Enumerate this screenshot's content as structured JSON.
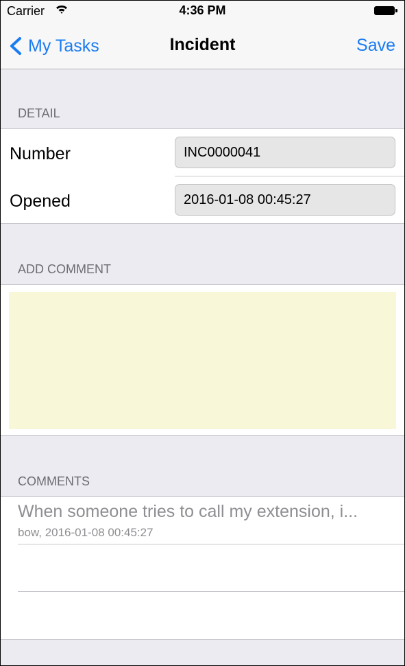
{
  "status_bar": {
    "carrier": "Carrier",
    "time": "4:36 PM"
  },
  "nav": {
    "back_label": "My Tasks",
    "title": "Incident",
    "save_label": "Save"
  },
  "detail": {
    "header": "DETAIL",
    "rows": [
      {
        "label": "Number",
        "value": "INC0000041"
      },
      {
        "label": "Opened",
        "value": "2016-01-08 00:45:27"
      }
    ]
  },
  "add_comment": {
    "header": "ADD COMMENT",
    "value": ""
  },
  "comments": {
    "header": "COMMENTS",
    "items": [
      {
        "text": "When someone tries to call my extension, i...",
        "meta": "bow, 2016-01-08 00:45:27"
      }
    ]
  },
  "colors": {
    "accent": "#1a7cf2",
    "grouped_background": "#ebebf1",
    "comment_box": "#f8f8d9",
    "field_background": "#e6e6e6"
  }
}
